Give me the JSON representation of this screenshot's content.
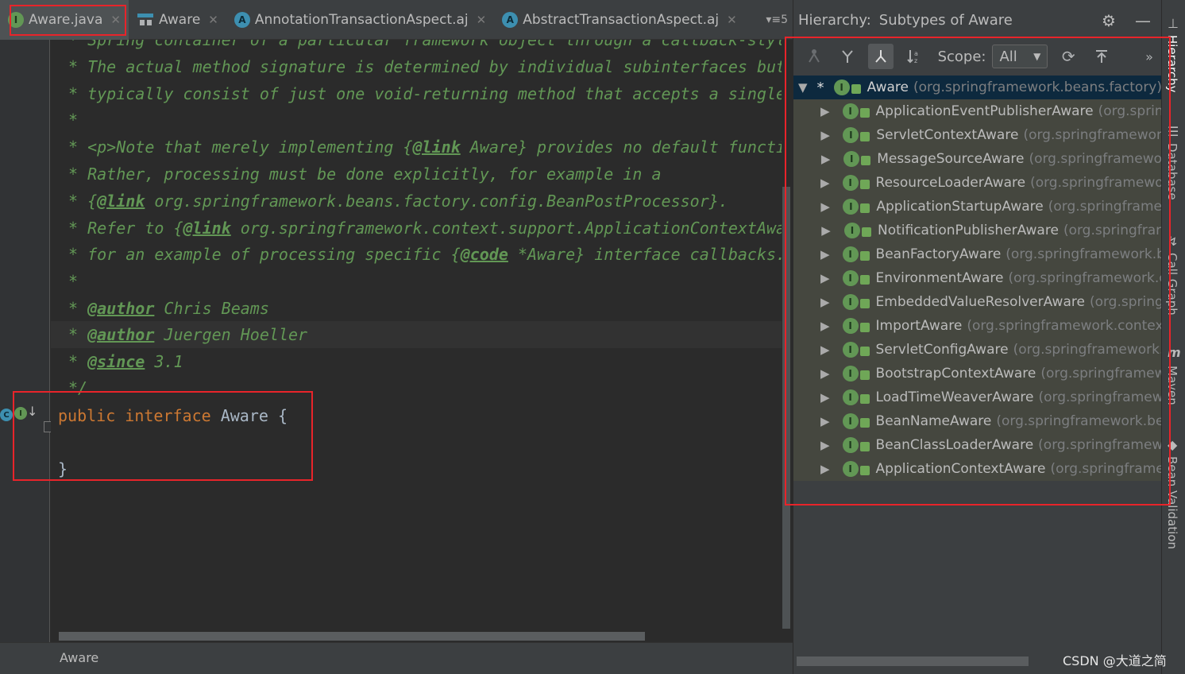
{
  "editor_tabs": [
    {
      "label": "Aware.java",
      "icon": "interface-icon",
      "active": true
    },
    {
      "label": "Aware",
      "icon": "hierarchy-icon",
      "active": false
    },
    {
      "label": "AnnotationTransactionAspect.aj",
      "icon": "aspect-icon",
      "active": false
    },
    {
      "label": "AbstractTransactionAspect.aj",
      "icon": "aspect-icon",
      "active": false
    }
  ],
  "tab_overflow_label": "▾≡5",
  "tab_close_glyph": "✕",
  "code": {
    "line0": "* Spring container of a particular framework object through a callback-style",
    "line1": "* The actual method signature is determined by individual subinterfaces but",
    "line2": "* typically consist of just one void-returning method that accepts a single",
    "line3": "*",
    "line4a": "* <p>Note that merely implementing {",
    "line4tag": "@link",
    "line4b": " Aware} provides no default functio",
    "line5": "* Rather, processing must be done explicitly, for example in a",
    "line6a": "* {",
    "line6tag": "@link",
    "line6b": " org.springframework.beans.factory.config.BeanPostProcessor}.",
    "line7a": "* Refer to {",
    "line7tag": "@link",
    "line7b": " org.springframework.context.support.ApplicationContextAwar",
    "line8a": "* for an example of processing specific {",
    "line8tag": "@code",
    "line8b": " *Aware} interface callbacks.",
    "line9": "*",
    "line10a": "* ",
    "line10tag": "@author",
    "line10b": " Chris Beams",
    "line11a": "* ",
    "line11tag": "@author",
    "line11b": " Juergen Hoeller",
    "line12a": "* ",
    "line12tag": "@since",
    "line12b": " 3.1",
    "line13": "*/",
    "decl_kw1": "public",
    "decl_kw2": "interface",
    "decl_name": "Aware {",
    "close_brace": "}"
  },
  "status_bar_text": "Aware",
  "hierarchy": {
    "title": "Hierarchy:",
    "subtitle": "Subtypes of Aware",
    "scope_label": "Scope:",
    "scope_value": "All",
    "root": {
      "name": "Aware",
      "package": "(org.springframework.beans.factory)"
    },
    "children": [
      {
        "name": "ApplicationEventPublisherAware",
        "package": "(org.sprin"
      },
      {
        "name": "ServletContextAware",
        "package": "(org.springframewor"
      },
      {
        "name": "MessageSourceAware",
        "package": "(org.springframewo"
      },
      {
        "name": "ResourceLoaderAware",
        "package": "(org.springframewo"
      },
      {
        "name": "ApplicationStartupAware",
        "package": "(org.springframe"
      },
      {
        "name": "NotificationPublisherAware",
        "package": "(org.springfrar"
      },
      {
        "name": "BeanFactoryAware",
        "package": "(org.springframework.b"
      },
      {
        "name": "EnvironmentAware",
        "package": "(org.springframework.c"
      },
      {
        "name": "EmbeddedValueResolverAware",
        "package": "(org.spring"
      },
      {
        "name": "ImportAware",
        "package": "(org.springframework.contex"
      },
      {
        "name": "ServletConfigAware",
        "package": "(org.springframework."
      },
      {
        "name": "BootstrapContextAware",
        "package": "(org.springframew"
      },
      {
        "name": "LoadTimeWeaverAware",
        "package": "(org.springframew"
      },
      {
        "name": "BeanNameAware",
        "package": "(org.springframework.be"
      },
      {
        "name": "BeanClassLoaderAware",
        "package": "(org.springframew"
      },
      {
        "name": "ApplicationContextAware",
        "package": "(org.springframe"
      }
    ]
  },
  "tool_strip": [
    {
      "label": "Hierarchy",
      "active": true
    },
    {
      "label": "Database",
      "active": false
    },
    {
      "label": "Call Graph",
      "active": false
    },
    {
      "label": "Maven",
      "active": false
    },
    {
      "label": "Bean Validation",
      "active": false
    }
  ],
  "watermark": "CSDN @大道之简",
  "colors": {
    "annotation_box": "#e8242a",
    "doc_comment": "#629755",
    "keyword": "#cc7832",
    "interface_icon": "#629755"
  }
}
